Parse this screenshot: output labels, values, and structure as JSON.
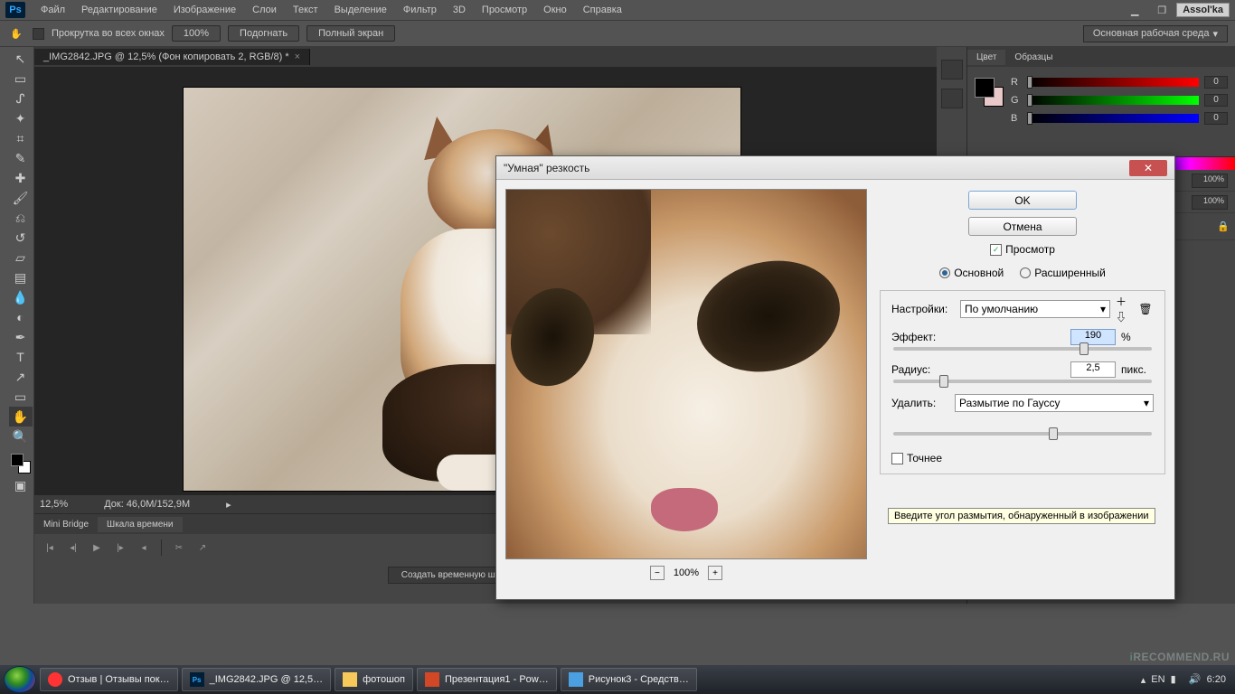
{
  "menubar": {
    "items": [
      "Файл",
      "Редактирование",
      "Изображение",
      "Слои",
      "Текст",
      "Выделение",
      "Фильтр",
      "3D",
      "Просмотр",
      "Окно",
      "Справка"
    ],
    "user": "Assol'ka"
  },
  "options": {
    "scroll_all": "Прокрутка во всех окнах",
    "zoom": "100%",
    "fit": "Подогнать",
    "fullscreen": "Полный экран",
    "workspace": "Основная рабочая среда"
  },
  "document": {
    "tab": "_IMG2842.JPG @ 12,5% (Фон копировать 2, RGB/8) *",
    "zoom": "12,5%",
    "docinfo": "Док: 46,0M/152,9M"
  },
  "timeline": {
    "tab_bridge": "Mini Bridge",
    "tab_time": "Шкала времени",
    "create_btn": "Создать временную шкалу для видео"
  },
  "color_panel": {
    "tab_color": "Цвет",
    "tab_swatches": "Образцы",
    "r": "R",
    "g": "G",
    "b": "B",
    "rv": "0",
    "gv": "0",
    "bv": "0"
  },
  "layers": {
    "opacity": "100%"
  },
  "dialog": {
    "title": "\"Умная\" резкость",
    "ok": "OK",
    "cancel": "Отмена",
    "preview_chk": "Просмотр",
    "mode_basic": "Основной",
    "mode_adv": "Расширенный",
    "settings_label": "Настройки:",
    "settings_value": "По умолчанию",
    "amount_label": "Эффект:",
    "amount_value": "190",
    "amount_unit": "%",
    "radius_label": "Радиус:",
    "radius_value": "2,5",
    "radius_unit": "пикс.",
    "remove_label": "Удалить:",
    "remove_value": "Размытие по Гауссу",
    "precise": "Точнее",
    "zoom_label": "100%",
    "tooltip": "Введите угол размытия, обнаруженный в изображении"
  },
  "taskbar": {
    "items": [
      "Отзыв | Отзывы пок…",
      "_IMG2842.JPG @ 12,5…",
      "фотошоп",
      "Презентация1 - Pow…",
      "Рисунок3 - Средств…"
    ],
    "lang": "EN",
    "time": "6:20"
  },
  "watermark": "RECOMMEND.RU"
}
